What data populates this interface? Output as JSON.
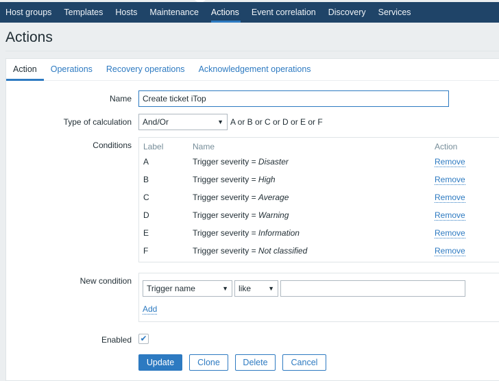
{
  "topnav": {
    "items": [
      "Host groups",
      "Templates",
      "Hosts",
      "Maintenance",
      "Actions",
      "Event correlation",
      "Discovery",
      "Services"
    ],
    "active": "Actions"
  },
  "page_title": "Actions",
  "tabs": [
    "Action",
    "Operations",
    "Recovery operations",
    "Acknowledgement operations"
  ],
  "form": {
    "name_label": "Name",
    "name_value": "Create ticket iTop",
    "calc_label": "Type of calculation",
    "calc_value": "And/Or",
    "calc_expression": "A or B or C or D or E or F",
    "conditions_label": "Conditions",
    "conditions_headers": [
      "Label",
      "Name",
      "Action"
    ],
    "conditions": [
      {
        "label": "A",
        "prefix": "Trigger severity = ",
        "value": "Disaster",
        "action": "Remove"
      },
      {
        "label": "B",
        "prefix": "Trigger severity = ",
        "value": "High",
        "action": "Remove"
      },
      {
        "label": "C",
        "prefix": "Trigger severity = ",
        "value": "Average",
        "action": "Remove"
      },
      {
        "label": "D",
        "prefix": "Trigger severity = ",
        "value": "Warning",
        "action": "Remove"
      },
      {
        "label": "E",
        "prefix": "Trigger severity = ",
        "value": "Information",
        "action": "Remove"
      },
      {
        "label": "F",
        "prefix": "Trigger severity = ",
        "value": "Not classified",
        "action": "Remove"
      }
    ],
    "new_condition_label": "New condition",
    "new_condition_type": "Trigger name",
    "new_condition_operator": "like",
    "new_condition_value": "",
    "add_label": "Add",
    "enabled_label": "Enabled",
    "enabled": true
  },
  "buttons": {
    "update": "Update",
    "clone": "Clone",
    "delete": "Delete",
    "cancel": "Cancel"
  }
}
